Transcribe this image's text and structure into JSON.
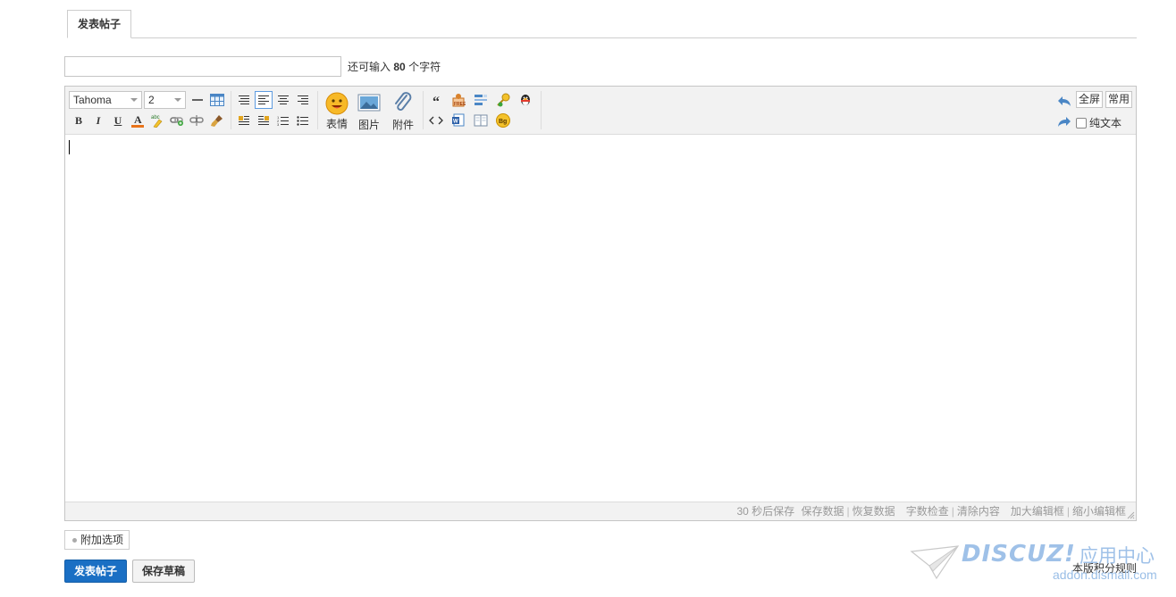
{
  "tab": {
    "label": "发表帖子"
  },
  "subject": {
    "value": "",
    "hint_prefix": "还可输入",
    "hint_count": "80",
    "hint_suffix": "个字符"
  },
  "toolbar": {
    "font_family": "Tahoma",
    "font_size": "2",
    "emoji_label": "表情",
    "image_label": "图片",
    "attach_label": "附件",
    "fullscreen_label": "全屏",
    "common_label": "常用",
    "plaintext_label": "纯文本"
  },
  "statusbar": {
    "autosave": "30 秒后保存",
    "save_data": "保存数据",
    "restore_data": "恢复数据",
    "word_check": "字数检查",
    "clear_content": "清除内容",
    "enlarge": "加大编辑框",
    "shrink": "缩小编辑框"
  },
  "extra_options_label": "附加选项",
  "submit_label": "发表帖子",
  "draft_label": "保存草稿",
  "rules_label": "本版积分规则",
  "watermark": {
    "brand": "DISCUZ!",
    "center": "应用中心",
    "url": "addon.dismall.com"
  },
  "colors": {
    "primary": "#1a6fc4",
    "border": "#c5c5c5",
    "toolbar_bg": "#f2f2f2"
  }
}
